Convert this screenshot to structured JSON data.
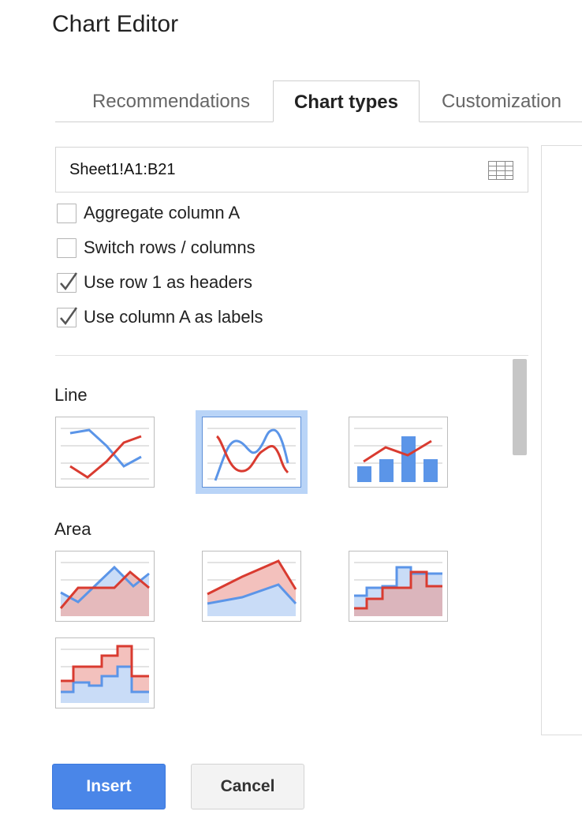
{
  "dialog": {
    "title": "Chart Editor"
  },
  "tabs": [
    {
      "label": "Recommendations",
      "active": false
    },
    {
      "label": "Chart types",
      "active": true
    },
    {
      "label": "Customization",
      "active": false
    }
  ],
  "range": {
    "value": "Sheet1!A1:B21",
    "icon": "grid-icon"
  },
  "options": [
    {
      "label": "Aggregate column A",
      "checked": false
    },
    {
      "label": "Switch rows / columns",
      "checked": false
    },
    {
      "label": "Use row 1 as headers",
      "checked": true
    },
    {
      "label": "Use column A as labels",
      "checked": true
    }
  ],
  "sections": {
    "line": {
      "label": "Line"
    },
    "area": {
      "label": "Area"
    }
  },
  "thumbnails": {
    "line": [
      "line-chart-icon",
      "smooth-line-chart-icon",
      "combo-chart-icon"
    ],
    "area": [
      "area-chart-icon",
      "stacked-area-chart-icon",
      "stepped-area-chart-icon",
      "stacked-stepped-area-chart-icon"
    ],
    "selected": "smooth-line-chart-icon"
  },
  "colors": {
    "blue": "#5b95e8",
    "red": "#d93b30",
    "blueFill": "#c9dcf7",
    "redFill": "#f3c1bd",
    "accent": "#4a86e8",
    "selection": "#b9d4f7"
  },
  "buttons": {
    "insert": "Insert",
    "cancel": "Cancel"
  }
}
